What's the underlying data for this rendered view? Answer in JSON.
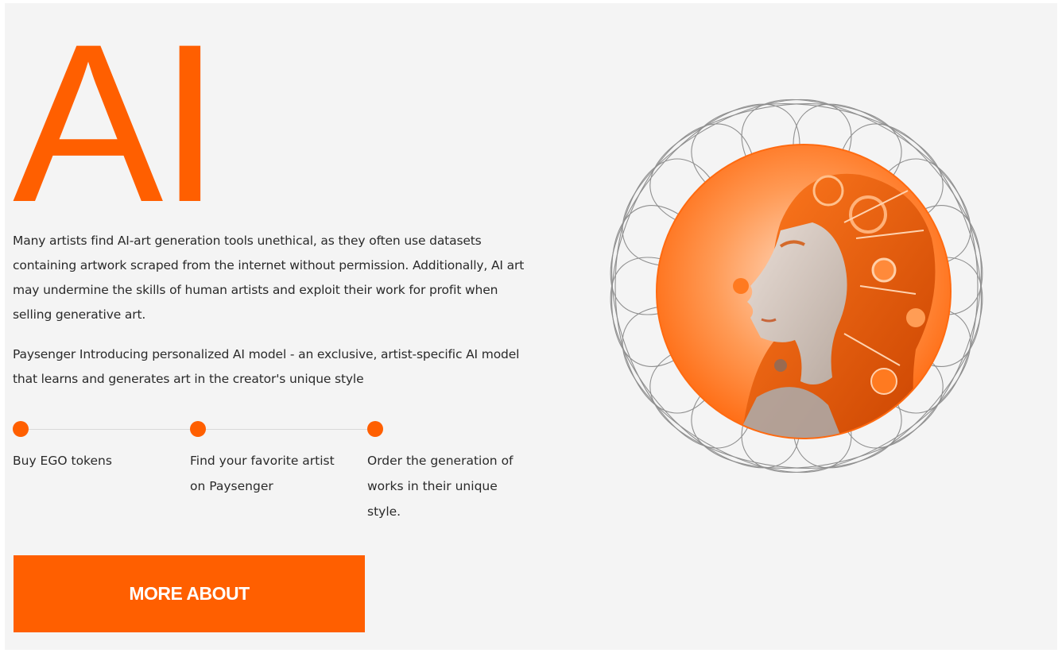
{
  "hero": {
    "title": "AI"
  },
  "description": {
    "paragraph_1": "Many artists find AI-art generation tools unethical, as they often use datasets containing artwork scraped from the internet without permission. Additionally, AI art may undermine the skills of human artists and exploit their work for profit when selling generative art.",
    "paragraph_2": "Paysenger Introducing personalized AI model - an exclusive, artist-specific AI model that learns and generates art in the creator's unique style"
  },
  "steps": [
    {
      "label": "Buy EGO tokens"
    },
    {
      "label": "Find your favorite artist on Paysenger"
    },
    {
      "label": "Order the generation of works in their unique style."
    }
  ],
  "cta": {
    "label": "MORE ABOUT"
  },
  "artwork": {
    "subject": "orange-portrait-illustration",
    "ornament": "spirograph-ring"
  },
  "colors": {
    "accent": "#ff5f00",
    "background": "#f4f4f4",
    "text": "#2a2a2a",
    "line": "#8a8a8a"
  }
}
